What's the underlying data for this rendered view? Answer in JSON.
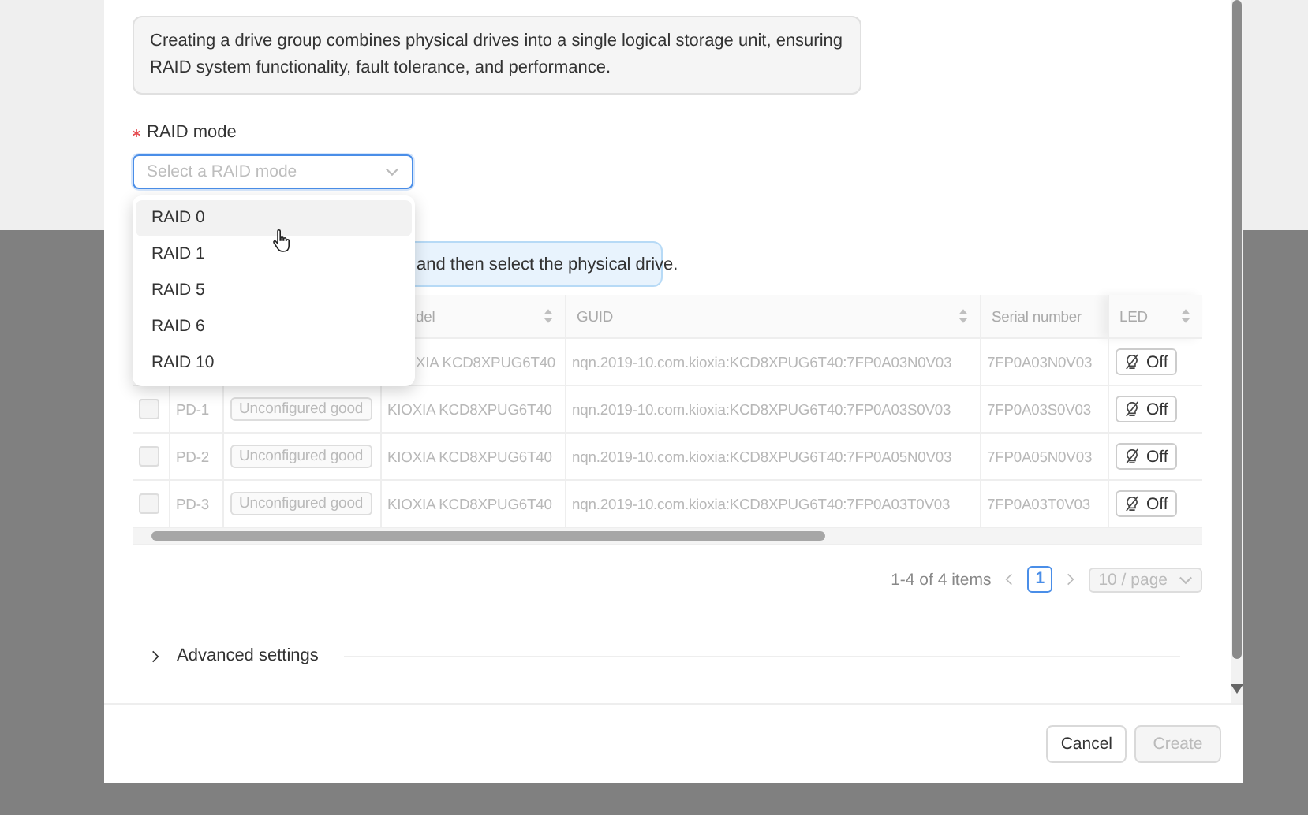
{
  "description": "Creating a drive group combines physical drives into a single logical storage unit, ensuring RAID system functionality, fault tolerance, and performance.",
  "raid_mode": {
    "label": "RAID mode",
    "required": true,
    "placeholder": "Select a RAID mode",
    "expanded": true,
    "options": [
      {
        "label": "RAID 0",
        "selected": true
      },
      {
        "label": "RAID 1",
        "selected": false
      },
      {
        "label": "RAID 5",
        "selected": false
      },
      {
        "label": "RAID 6",
        "selected": false
      },
      {
        "label": "RAID 10",
        "selected": false
      }
    ]
  },
  "alert": {
    "text": "and then select the physical drive."
  },
  "table": {
    "columns": [
      {
        "label": "del",
        "sortable": true
      },
      {
        "label": "GUID",
        "sortable": true
      },
      {
        "label": "Serial number",
        "sortable": false
      },
      {
        "label": "LED",
        "sortable": true
      }
    ],
    "rows": [
      {
        "model": "XIA KCD8XPUG6T40",
        "guid": "nqn.2019-10.com.kioxia:KCD8XPUG6T40:7FP0A03N0V03",
        "serial": "7FP0A03N0V03",
        "led": "Off",
        "disabled": true
      },
      {
        "checked": false,
        "id": "PD-1",
        "status": "Unconfigured good",
        "model": "KIOXIA KCD8XPUG6T40",
        "guid": "nqn.2019-10.com.kioxia:KCD8XPUG6T40:7FP0A03S0V03",
        "serial": "7FP0A03S0V03",
        "led": "Off",
        "disabled": true
      },
      {
        "checked": false,
        "id": "PD-2",
        "status": "Unconfigured good",
        "model": "KIOXIA KCD8XPUG6T40",
        "guid": "nqn.2019-10.com.kioxia:KCD8XPUG6T40:7FP0A05N0V03",
        "serial": "7FP0A05N0V03",
        "led": "Off",
        "disabled": true
      },
      {
        "checked": false,
        "id": "PD-3",
        "status": "Unconfigured good",
        "model": "KIOXIA KCD8XPUG6T40",
        "guid": "nqn.2019-10.com.kioxia:KCD8XPUG6T40:7FP0A03T0V03",
        "serial": "7FP0A03T0V03",
        "led": "Off",
        "disabled": true
      }
    ]
  },
  "pagination": {
    "summary": "1-4 of 4 items",
    "pages": [
      {
        "label": "1",
        "selected": true
      }
    ],
    "page_size": "10 / page",
    "page_size_disabled": true
  },
  "advanced": {
    "label": "Advanced settings",
    "expanded": false
  },
  "buttons": [
    {
      "label": "Cancel",
      "disabled": false
    },
    {
      "label": "Create",
      "disabled": true
    }
  ]
}
